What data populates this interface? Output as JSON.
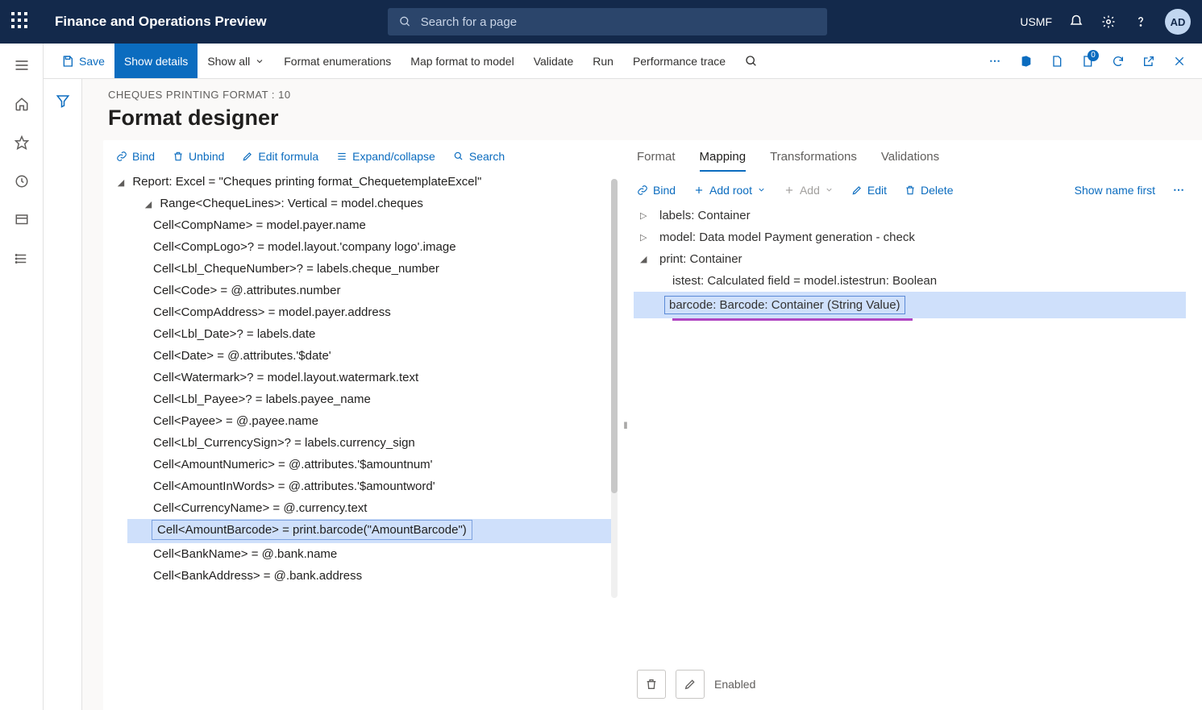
{
  "topbar": {
    "title": "Finance and Operations Preview",
    "search_placeholder": "Search for a page",
    "company": "USMF",
    "avatar_initials": "AD"
  },
  "cmdbar": {
    "save": "Save",
    "show_details": "Show details",
    "show_all": "Show all",
    "format_enum": "Format enumerations",
    "map_format": "Map format to model",
    "validate": "Validate",
    "run": "Run",
    "perf_trace": "Performance trace",
    "badge_count": "0"
  },
  "page": {
    "breadcrumb": "CHEQUES PRINTING FORMAT : 10",
    "title": "Format designer"
  },
  "left_actions": {
    "bind": "Bind",
    "unbind": "Unbind",
    "edit_formula": "Edit formula",
    "expand": "Expand/collapse",
    "search": "Search"
  },
  "format_tree": {
    "root": "Report: Excel = \"Cheques printing format_ChequetemplateExcel\"",
    "range": "Range<ChequeLines>: Vertical = model.cheques",
    "cells": [
      "Cell<CompName> = model.payer.name",
      "Cell<CompLogo>? = model.layout.'company logo'.image",
      "Cell<Lbl_ChequeNumber>? = labels.cheque_number",
      "Cell<Code> = @.attributes.number",
      "Cell<CompAddress> = model.payer.address",
      "Cell<Lbl_Date>? = labels.date",
      "Cell<Date> = @.attributes.'$date'",
      "Cell<Watermark>? = model.layout.watermark.text",
      "Cell<Lbl_Payee>? = labels.payee_name",
      "Cell<Payee> = @.payee.name",
      "Cell<Lbl_CurrencySign>? = labels.currency_sign",
      "Cell<AmountNumeric> = @.attributes.'$amountnum'",
      "Cell<AmountInWords> = @.attributes.'$amountword'",
      "Cell<CurrencyName> = @.currency.text",
      "Cell<AmountBarcode> = print.barcode(\"AmountBarcode\")",
      "Cell<BankName> = @.bank.name",
      "Cell<BankAddress> = @.bank.address"
    ],
    "selected_index": 14
  },
  "right_tabs": {
    "format": "Format",
    "mapping": "Mapping",
    "transformations": "Transformations",
    "validations": "Validations"
  },
  "right_actions": {
    "bind": "Bind",
    "add_root": "Add root",
    "add": "Add",
    "edit": "Edit",
    "delete": "Delete",
    "show_name_first": "Show name first"
  },
  "mapping_tree": {
    "labels": "labels: Container",
    "model": "model: Data model Payment generation - check",
    "print": "print: Container",
    "istest": "istest: Calculated field = model.istestrun: Boolean",
    "barcode": "barcode: Barcode: Container (String Value)"
  },
  "bottom": {
    "status": "Enabled"
  }
}
